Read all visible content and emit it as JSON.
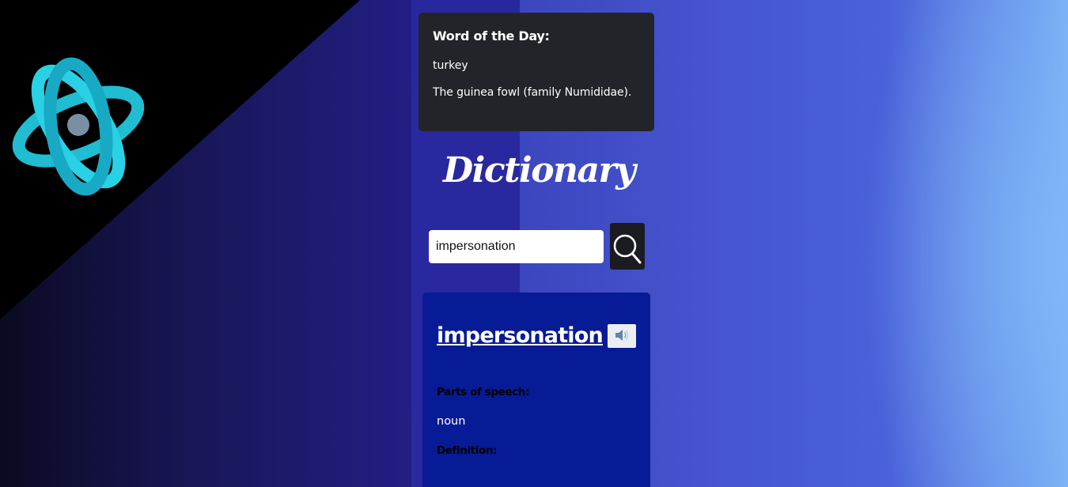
{
  "word_of_the_day": {
    "title": "Word of the Day:",
    "word": "turkey",
    "definition": "The guinea fowl (family Numididae)."
  },
  "app": {
    "title": "Dictionary"
  },
  "search": {
    "value": "impersonation",
    "placeholder": ""
  },
  "result": {
    "word": "impersonation",
    "parts_of_speech_label": "Parts of speech:",
    "part_of_speech": "noun",
    "definition_label": "Definition:"
  },
  "icons": {
    "logo": "react-atom-icon",
    "search": "search-icon",
    "audio": "speaker-icon"
  },
  "colors": {
    "logo_cyan": "#1fc6dc",
    "card_dark": "#232429",
    "result_card": "#071b96",
    "search_button": "#1b1c22"
  }
}
